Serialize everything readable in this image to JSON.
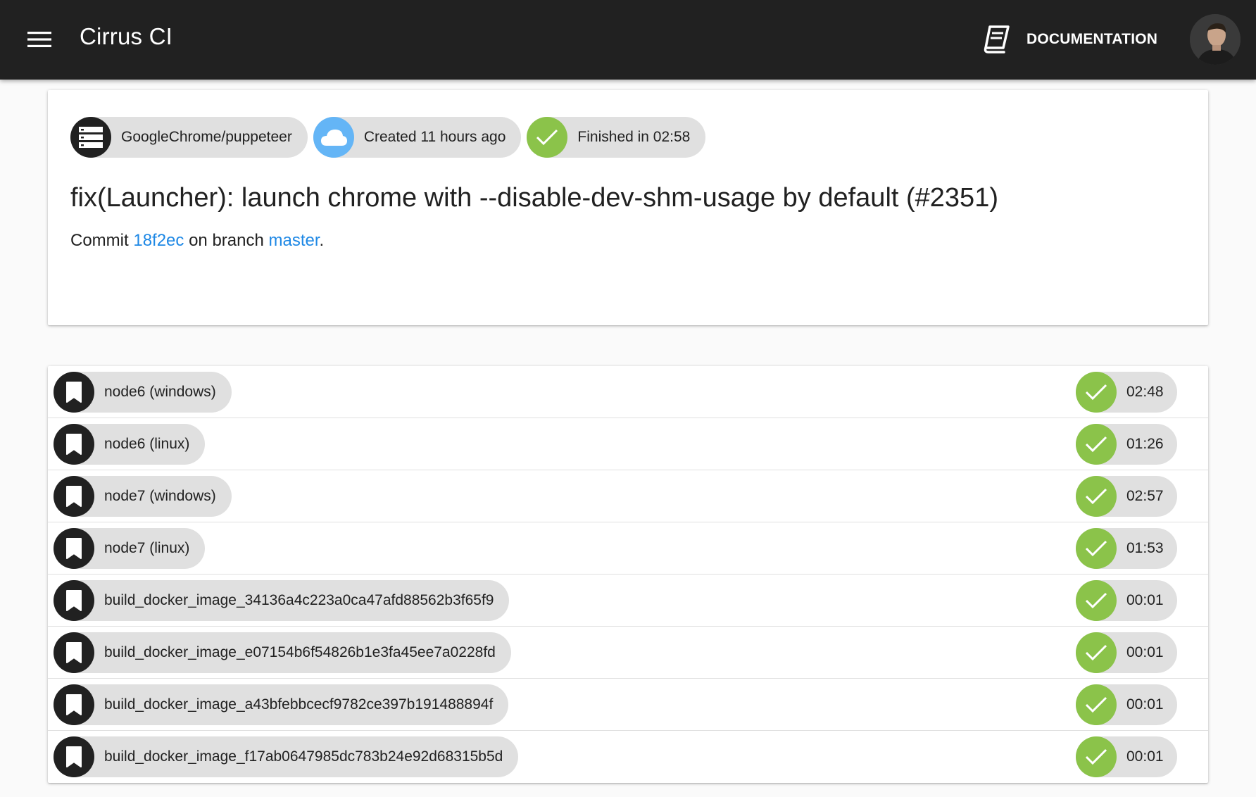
{
  "appbar": {
    "title": "Cirrus CI",
    "documentation_label": "DOCUMENTATION"
  },
  "build": {
    "repo": "GoogleChrome/puppeteer",
    "created": "Created 11 hours ago",
    "finished": "Finished in 02:58",
    "commit_message": "fix(Launcher): launch chrome with --disable-dev-shm-usage by default (#2351)",
    "commit_prefix": "Commit ",
    "commit_sha": "18f2ec",
    "branch_prefix": " on branch ",
    "branch": "master",
    "suffix": "."
  },
  "tasks": [
    {
      "name": "node6 (windows)",
      "duration": "02:48",
      "status": "success"
    },
    {
      "name": "node6 (linux)",
      "duration": "01:26",
      "status": "success"
    },
    {
      "name": "node7 (windows)",
      "duration": "02:57",
      "status": "success"
    },
    {
      "name": "node7 (linux)",
      "duration": "01:53",
      "status": "success"
    },
    {
      "name": "build_docker_image_34136a4c223a0ca47afd88562b3f65f9",
      "duration": "00:01",
      "status": "success"
    },
    {
      "name": "build_docker_image_e07154b6f54826b1e3fa45ee7a0228fd",
      "duration": "00:01",
      "status": "success"
    },
    {
      "name": "build_docker_image_a43bfebbcecf9782ce397b191488894f",
      "duration": "00:01",
      "status": "success"
    },
    {
      "name": "build_docker_image_f17ab0647985dc783b24e92d68315b5d",
      "duration": "00:01",
      "status": "success"
    }
  ],
  "colors": {
    "appbar": "#212121",
    "success": "#8bc34a",
    "cloud": "#64b5f6",
    "link": "#1e88e5",
    "chip": "#e0e0e0"
  },
  "icons": {
    "menu": "menu-icon",
    "documentation": "book-icon",
    "repo": "storage-icon",
    "created": "cloud-icon",
    "finished": "check-icon",
    "task": "bookmark-icon"
  }
}
